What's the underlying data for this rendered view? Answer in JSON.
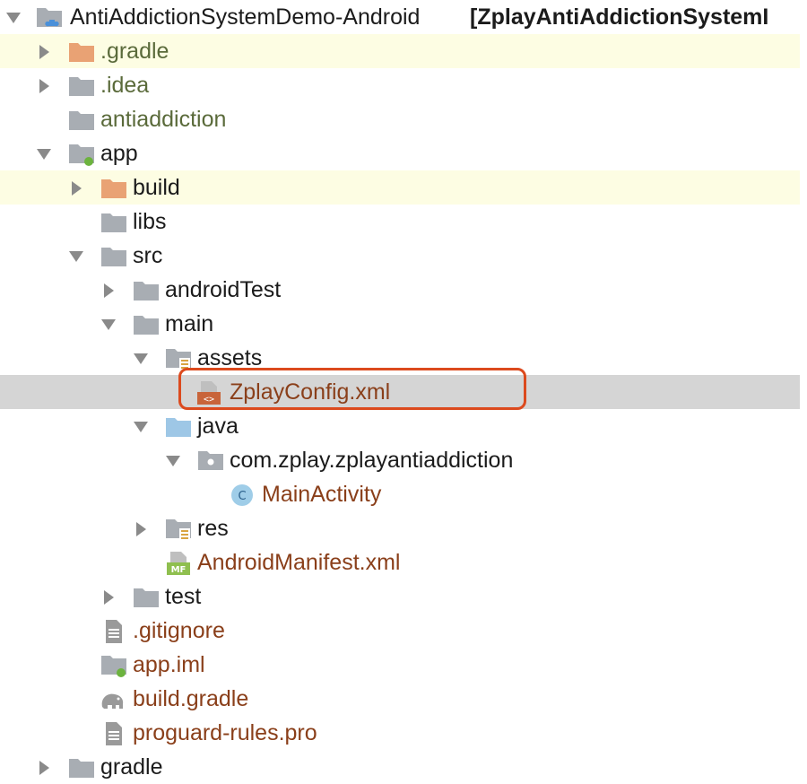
{
  "project": {
    "root_name": "AntiAddictionSystemDemo-Android",
    "root_module": "[ZplayAntiAddictionSystemI"
  },
  "tree": {
    "gradle_hidden": ".gradle",
    "idea": ".idea",
    "antiaddiction": "antiaddiction",
    "app": "app",
    "build": "build",
    "libs": "libs",
    "src": "src",
    "androidTest": "androidTest",
    "main": "main",
    "assets": "assets",
    "zplay_config": "ZplayConfig.xml",
    "java": "java",
    "package": "com.zplay.zplayantiaddiction",
    "main_activity": "MainActivity",
    "res": "res",
    "manifest": "AndroidManifest.xml",
    "test": "test",
    "gitignore": ".gitignore",
    "app_iml": "app.iml",
    "build_gradle": "build.gradle",
    "proguard": "proguard-rules.pro",
    "gradle": "gradle"
  },
  "icons": {
    "class_badge": "C",
    "manifest_badge": "MF",
    "xml_badge": "<>"
  },
  "colors": {
    "highlight": "#dc4a1e",
    "selection": "#d5d5d5",
    "excluded_folder": "#e9a274",
    "folder": "#a8adb3"
  }
}
